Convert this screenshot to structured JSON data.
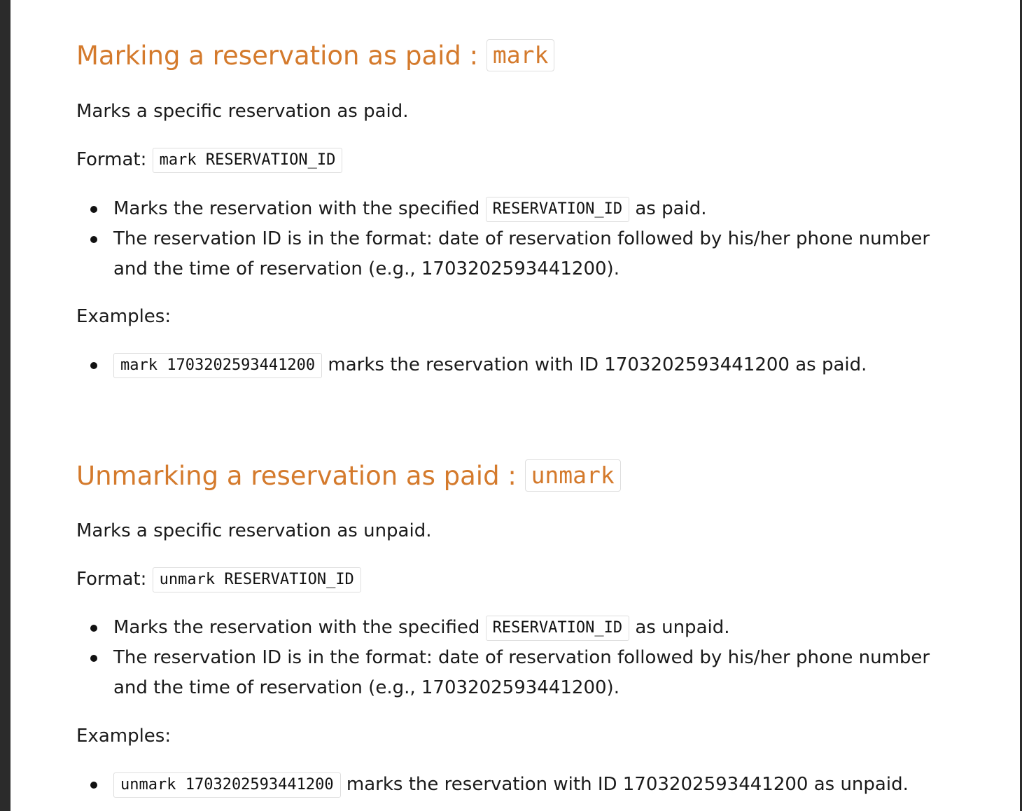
{
  "sections": [
    {
      "heading_text": "Marking a reservation as paid :",
      "heading_code": "mark",
      "description": "Marks a specific reservation as paid.",
      "format_label": "Format:",
      "format_code": "mark RESERVATION_ID",
      "bullets": [
        {
          "prefix": "Marks the reservation with the specified",
          "code": "RESERVATION_ID",
          "suffix": "as paid."
        },
        {
          "text": "The reservation ID is in the format: date of reservation followed by his/her phone number and the time of reservation (e.g., 1703202593441200)."
        }
      ],
      "examples_label": "Examples:",
      "examples": [
        {
          "code": "mark 1703202593441200",
          "text": "marks the reservation with ID 1703202593441200 as paid."
        }
      ]
    },
    {
      "heading_text": "Unmarking a reservation as paid :",
      "heading_code": "unmark",
      "description": "Marks a specific reservation as unpaid.",
      "format_label": "Format:",
      "format_code": "unmark RESERVATION_ID",
      "bullets": [
        {
          "prefix": "Marks the reservation with the specified",
          "code": "RESERVATION_ID",
          "suffix": "as unpaid."
        },
        {
          "text": "The reservation ID is in the format: date of reservation followed by his/her phone number and the time of reservation (e.g., 1703202593441200)."
        }
      ],
      "examples_label": "Examples:",
      "examples": [
        {
          "code": "unmark 1703202593441200",
          "text": "marks the reservation with ID 1703202593441200 as unpaid."
        }
      ]
    }
  ],
  "colors": {
    "heading": "#d47a2c",
    "text": "#1a1a1a",
    "code_border": "#dedede",
    "side_rail": "#2b2b2b"
  }
}
